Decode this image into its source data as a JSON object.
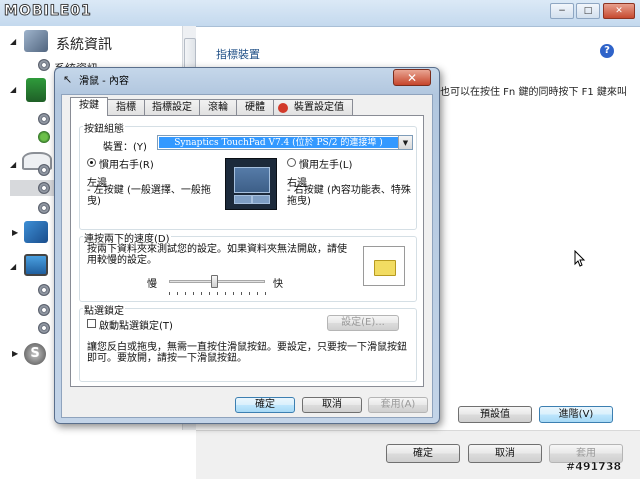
{
  "logo_text": "MOBILE01",
  "window_controls": {
    "minimize": "−",
    "maximize": "□",
    "close": "✕"
  },
  "tree": {
    "title": "系統資訊",
    "subitem": "系統資訊"
  },
  "panel": {
    "title": "指標裝置",
    "help_label": "?",
    "fn_text": "也可以在按住 Fn 鍵的同時按下 F1 鍵來叫"
  },
  "outer_buttons": {
    "defaults": "預設值",
    "advanced": "進階(V)",
    "ok": "確定",
    "cancel": "取消",
    "apply": "套用"
  },
  "watermark": "#491738",
  "dialog": {
    "title": "滑鼠 - 內容",
    "close_label": "✕",
    "tabs": [
      "按鍵",
      "指標",
      "指標設定",
      "滾輪",
      "硬體",
      "裝置設定值"
    ],
    "button_config": {
      "legend": "按鈕組態",
      "device_label": "裝置：(Y)",
      "device_value": "Synaptics TouchPad V7.4 (位於 PS/2 的連接埠 )",
      "right_hand": "慣用右手(R)",
      "left_hand": "慣用左手(L)",
      "left_title": "左邊",
      "left_desc": "- 左按鍵 (一般選擇、一般拖曳)",
      "right_title": "右邊",
      "right_desc": "- 右按鍵 (內容功能表、特殊拖曳)"
    },
    "double_click": {
      "legend": "連按兩下的速度(D)",
      "desc": "按兩下資料夾來測試您的設定。如果資料夾無法開啟，請使用較慢的設定。",
      "slow": "慢",
      "fast": "快",
      "speed_fraction": 0.47
    },
    "click_lock": {
      "legend": "點選鎖定",
      "enable": "啟動點選鎖定(T)",
      "settings_button": "設定(E)...",
      "desc": "讓您反白或拖曳，無需一直按住滑鼠按鈕。要設定，只要按一下滑鼠按鈕即可。要放開，請按一下滑鼠按鈕。"
    },
    "buttons": {
      "ok": "確定",
      "cancel": "取消",
      "apply": "套用(A)"
    }
  }
}
